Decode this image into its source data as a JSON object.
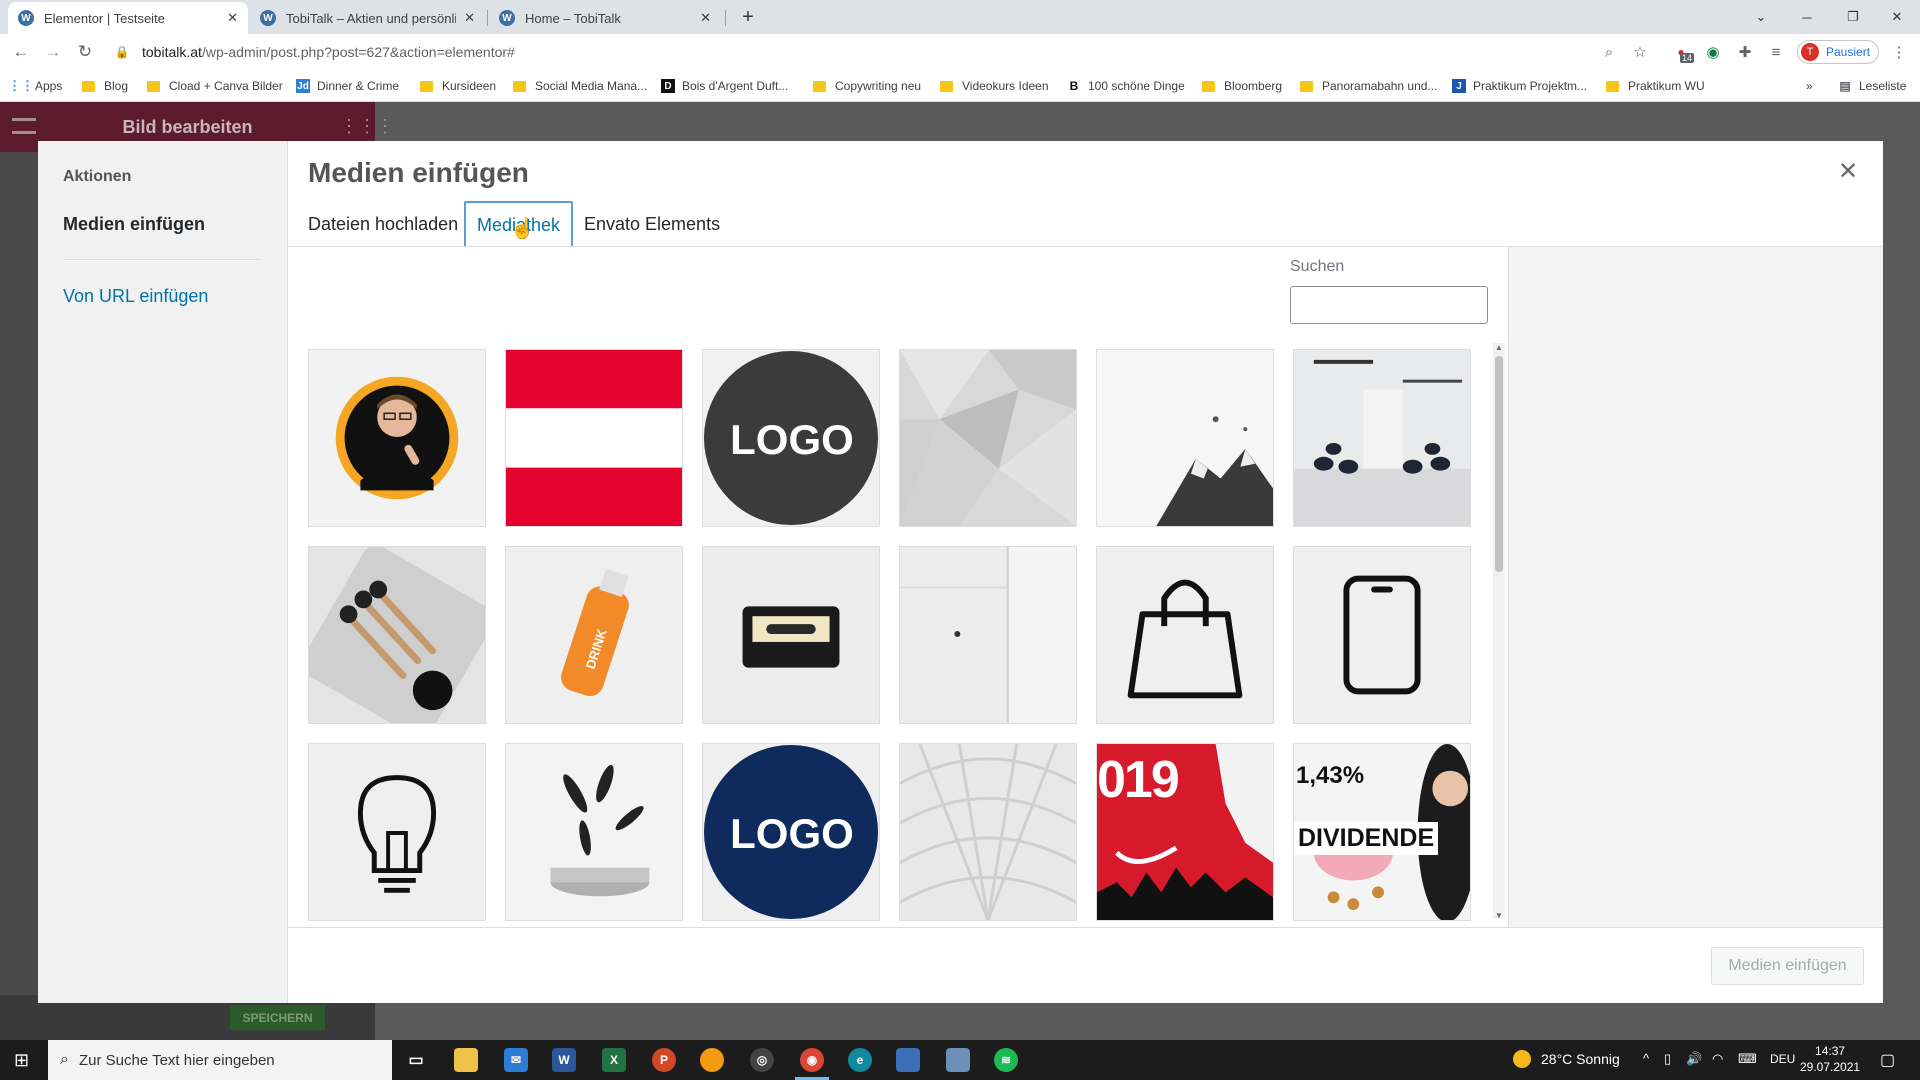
{
  "browser": {
    "tabs": [
      {
        "title": "Elementor | Testseite",
        "active": true
      },
      {
        "title": "TobiTalk – Aktien und persönliche",
        "active": false
      },
      {
        "title": "Home – TobiTalk",
        "active": false
      }
    ],
    "url_host": "tobitalk.at",
    "url_path": "/wp-admin/post.php?post=627&action=elementor#",
    "profile_label": "Pausiert",
    "profile_initial": "T",
    "extension_badge": "14",
    "bookmarks": [
      "Apps",
      "Blog",
      "Cload + Canva Bilder",
      "Dinner & Crime",
      "Kursideen",
      "Social Media Mana...",
      "Bois d'Argent Duft...",
      "Copywriting neu",
      "Videokurs Ideen",
      "100 schöne Dinge",
      "Bloomberg",
      "Panoramabahn und...",
      "Praktikum Projektm...",
      "Praktikum WU"
    ],
    "reading_list": "Leseliste"
  },
  "editor": {
    "panel_title": "Bild bearbeiten",
    "save_label": "SPEICHERN"
  },
  "modal": {
    "sidebar_title": "Aktionen",
    "sidebar_active": "Medien einfügen",
    "sidebar_link": "Von URL einfügen",
    "title": "Medien einfügen",
    "tabs": [
      "Dateien hochladen",
      "Mediathek",
      "Envato Elements"
    ],
    "active_tab": "Mediathek",
    "search_label": "Suchen",
    "search_value": "",
    "insert_button": "Medien einfügen",
    "thumbnails": [
      {
        "label": ""
      },
      {
        "label": ""
      },
      {
        "label": "LOGO"
      },
      {
        "label": ""
      },
      {
        "label": ""
      },
      {
        "label": ""
      },
      {
        "label": ""
      },
      {
        "label": "DRINK"
      },
      {
        "label": ""
      },
      {
        "label": ""
      },
      {
        "label": ""
      },
      {
        "label": ""
      },
      {
        "label": ""
      },
      {
        "label": ""
      },
      {
        "label": "LOGO"
      },
      {
        "label": ""
      },
      {
        "label": "019"
      },
      {
        "label": "DIVIDENDE"
      }
    ],
    "thumb_pct": "1,43%"
  },
  "taskbar": {
    "search_placeholder": "Zur Suche Text hier eingeben",
    "weather": "28°C  Sonnig",
    "lang": "DEU",
    "time": "14:37",
    "date": "29.07.2021"
  },
  "colors": {
    "accent": "#0073aa",
    "elementor_header": "#5b1a2e",
    "logo_dark": "#3b3b3b",
    "logo_navy": "#0f2a5c",
    "austria_red": "#e4032e"
  }
}
